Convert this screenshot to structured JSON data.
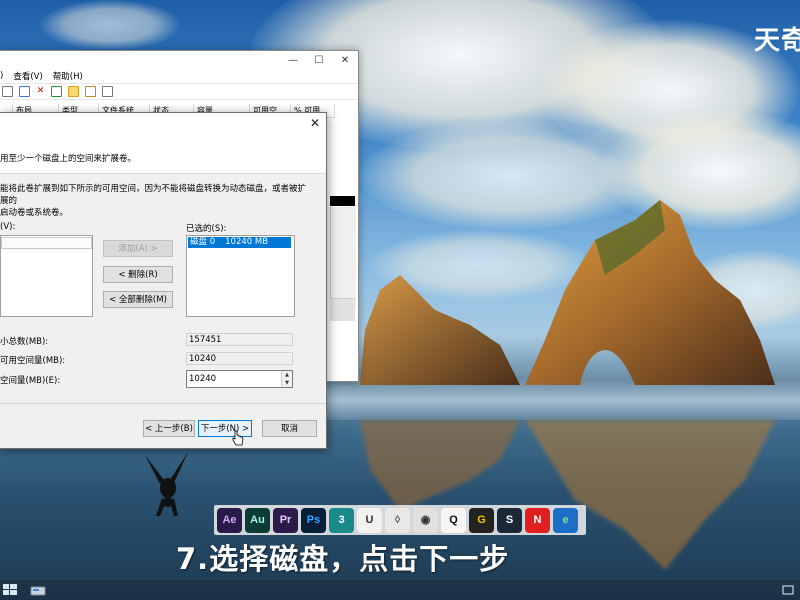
{
  "overlay": {
    "brand": "天奇",
    "caption": "7.选择磁盘，点击下一步"
  },
  "explorer": {
    "menu": [
      ")",
      "查看(V)",
      "帮助(H)"
    ],
    "columns": [
      "",
      "布局",
      "类型",
      "文件系统",
      "状态",
      "容量",
      "可用空...",
      "% 可用"
    ]
  },
  "wizard": {
    "close": "✕",
    "subtitle": "用至少一个磁盘上的空间来扩展卷。",
    "description_line1": "能将此卷扩展到如下所示的可用空间，因为不能将磁盘转换为动态磁盘，或者被扩展的",
    "description_line2": "启动卷或系统卷。",
    "available_label": "(V):",
    "selected_label": "已选的(S):",
    "selected_items": [
      {
        "disk": "磁盘 0",
        "size": "10240 MB"
      }
    ],
    "add_button": "添加(A) >",
    "remove_button": "< 删除(R)",
    "remove_all_button": "< 全部删除(M)",
    "total_label": "小总数(MB):",
    "total_value": "157451",
    "max_label": "可用空间量(MB):",
    "max_value": "10240",
    "amount_label": "空间量(MB)(E):",
    "amount_value": "10240",
    "back_button": "< 上一步(B)",
    "next_button": "下一步(N) >",
    "cancel_button": "取消"
  },
  "apps": [
    {
      "name": "Ae",
      "color": "#2a1a4a",
      "fg": "#d2a8ff"
    },
    {
      "name": "Au",
      "color": "#0b3b33",
      "fg": "#9ff5e3"
    },
    {
      "name": "Pr",
      "color": "#2b1a4a",
      "fg": "#e9c8ff"
    },
    {
      "name": "Ps",
      "color": "#061e36",
      "fg": "#31a8ff"
    },
    {
      "name": "3",
      "color": "#1a8a8a",
      "fg": "#ffffff"
    },
    {
      "name": "U",
      "color": "#f2f2f2",
      "fg": "#333333"
    },
    {
      "name": "◊",
      "color": "#e8e8e8",
      "fg": "#555555"
    },
    {
      "name": "◉",
      "color": "#e0e0e0",
      "fg": "#333333"
    },
    {
      "name": "Q",
      "color": "#f5f5f5",
      "fg": "#111111"
    },
    {
      "name": "G",
      "color": "#222222",
      "fg": "#f5c400"
    },
    {
      "name": "S",
      "color": "#1b2838",
      "fg": "#ffffff"
    },
    {
      "name": "N",
      "color": "#e02020",
      "fg": "#ffffff"
    },
    {
      "name": "e",
      "color": "#1b6fc7",
      "fg": "#7fe08a"
    }
  ]
}
